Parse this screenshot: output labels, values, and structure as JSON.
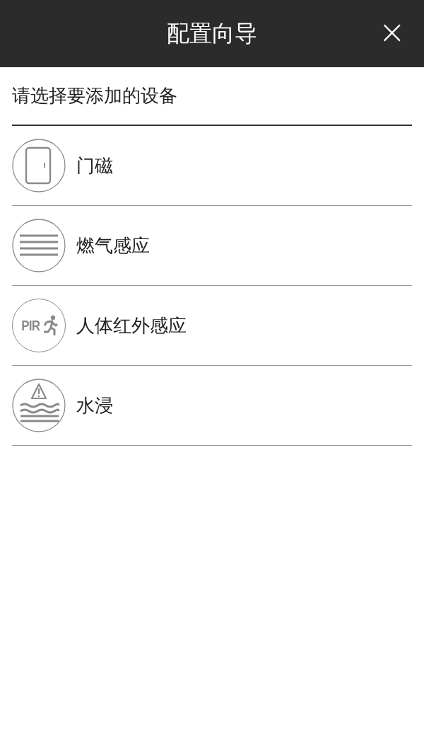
{
  "header": {
    "title": "配置向导",
    "close": "×"
  },
  "prompt": "请选择要添加的设备",
  "devices": [
    {
      "kind": "door",
      "label": "门磁"
    },
    {
      "kind": "gas",
      "label": "燃气感应"
    },
    {
      "kind": "pir",
      "label": "人体红外感应",
      "icon_label": "PIR"
    },
    {
      "kind": "water",
      "label": "水浸"
    }
  ]
}
